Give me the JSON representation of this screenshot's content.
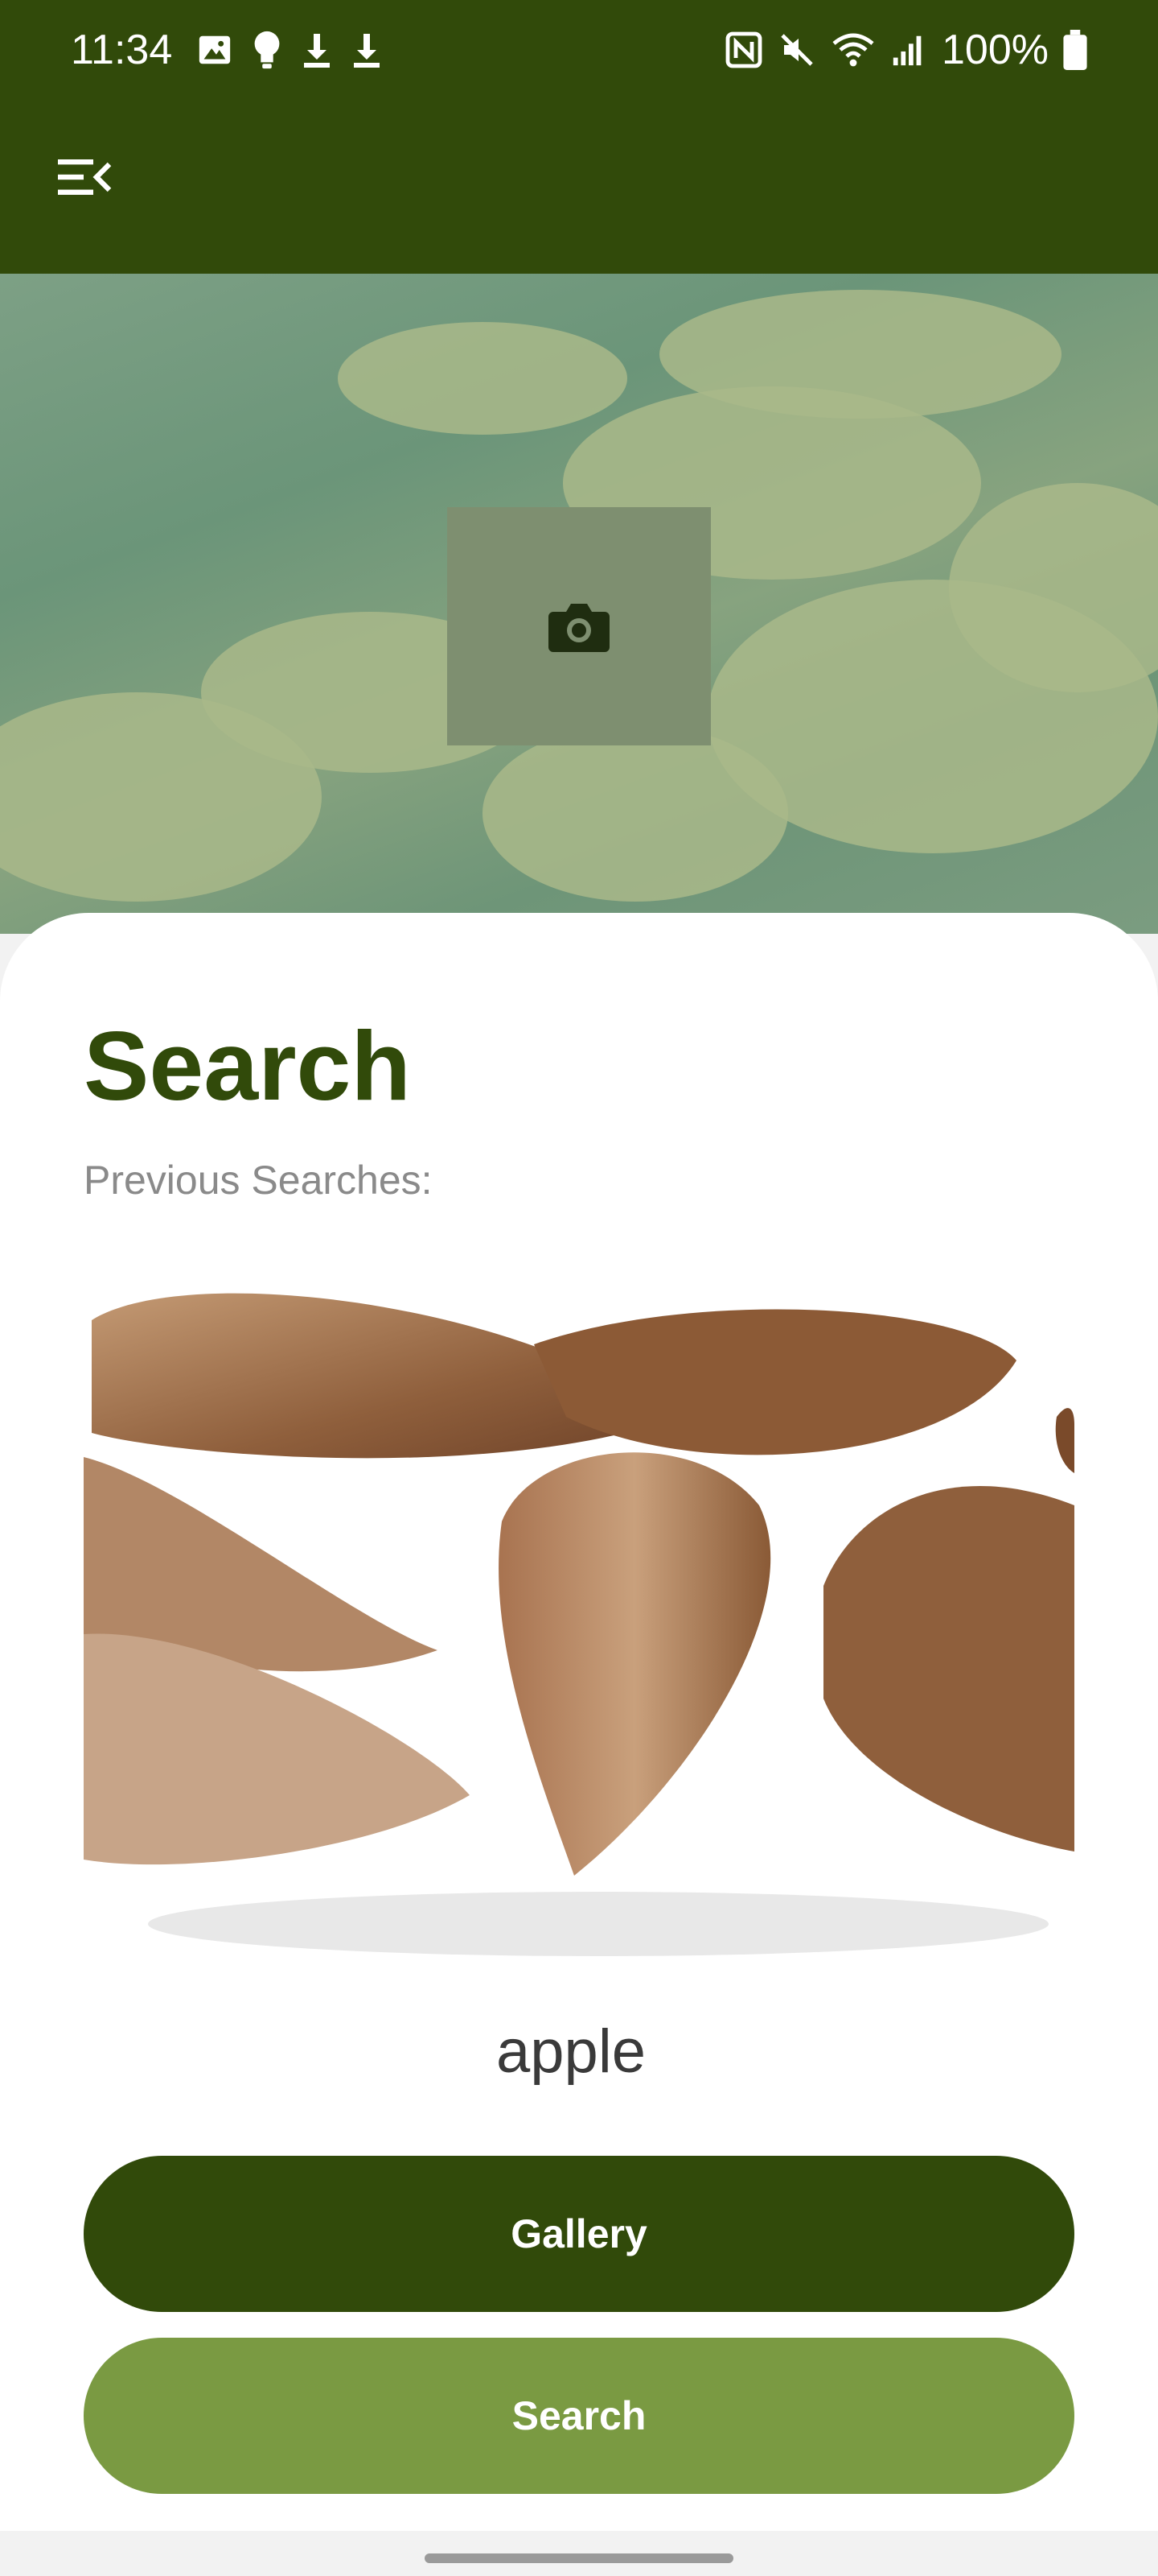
{
  "status_bar": {
    "time": "11:34",
    "battery_text": "100%",
    "left_icons": [
      "gallery-icon",
      "lightbulb-icon",
      "download-icon",
      "download-icon"
    ],
    "right_icons": [
      "nfc-icon",
      "mute-icon",
      "wifi-icon",
      "signal-icon",
      "battery-icon"
    ]
  },
  "app_bar": {
    "menu_icon": "menu-collapse-icon"
  },
  "hero": {
    "camera_icon": "camera-icon"
  },
  "content": {
    "title": "Search",
    "previous_label": "Previous Searches:",
    "result_label": "apple"
  },
  "buttons": {
    "gallery_label": "Gallery",
    "search_label": "Search"
  },
  "colors": {
    "primary": "#314a0a",
    "accent": "#7a9a42",
    "text_muted": "#8a8a8a"
  }
}
